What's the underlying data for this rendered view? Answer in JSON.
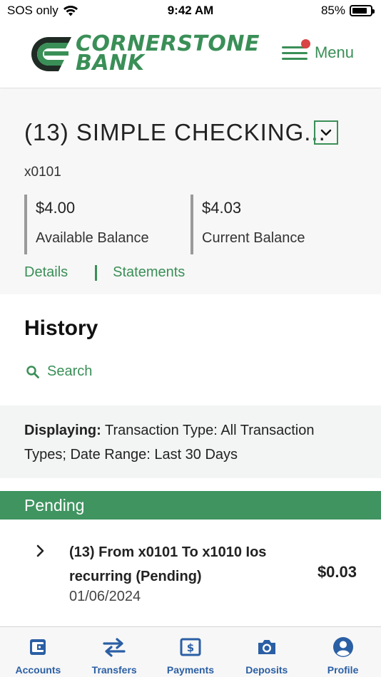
{
  "status_bar": {
    "carrier": "SOS only",
    "time": "9:42 AM",
    "battery_pct": "85%",
    "battery_level": 0.85
  },
  "header": {
    "logo_line1": "CORNERSTONE",
    "logo_line2": "BANK",
    "menu_label": "Menu"
  },
  "account": {
    "title": "(13) SIMPLE CHECKING...",
    "number": "x0101",
    "available_amount": "$4.00",
    "available_label": "Available Balance",
    "current_amount": "$4.03",
    "current_label": "Current Balance",
    "details_link": "Details",
    "statements_link": "Statements"
  },
  "history": {
    "title": "History",
    "search_label": "Search",
    "filter_prefix": "Displaying:",
    "filter_text": "Transaction Type: All Transaction Types; Date Range: Last 30 Days",
    "pending_label": "Pending",
    "transactions": [
      {
        "description": "(13) From x0101 To x1010 Ios recurring (Pending)",
        "date": "01/06/2024",
        "amount": "$0.03"
      }
    ]
  },
  "tabbar": {
    "tabs": [
      {
        "label": "Accounts",
        "icon": "wallet-icon"
      },
      {
        "label": "Transfers",
        "icon": "transfer-arrows-icon"
      },
      {
        "label": "Payments",
        "icon": "dollar-bill-icon"
      },
      {
        "label": "Deposits",
        "icon": "camera-icon"
      },
      {
        "label": "Profile",
        "icon": "user-circle-icon"
      }
    ]
  },
  "colors": {
    "brand_green": "#3a8f57",
    "pending_green": "#3f9460",
    "tab_blue": "#2b5fa4",
    "notification_red": "#d94444"
  }
}
